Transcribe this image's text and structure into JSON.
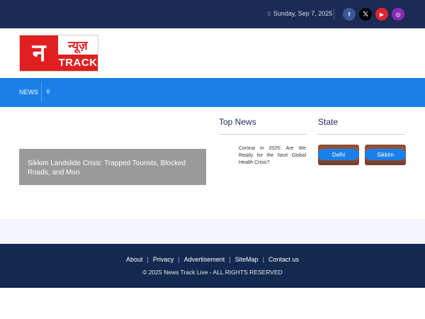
{
  "topbar": {
    "date": "Sunday, Sep 7, 2025",
    "social": [
      "facebook-icon",
      "x-icon",
      "youtube-icon",
      "instagram-icon"
    ]
  },
  "logo": {
    "mark": "न",
    "hindi": "न्यूज़",
    "word": "TRACK"
  },
  "nav": {
    "items": [
      "NEWS"
    ]
  },
  "feature": {
    "title": "Sikkim Landslide Crisis: Trapped Tourists, Blocked Roads, and Mon"
  },
  "top_news": {
    "heading": "Top News",
    "items": [
      "Corona in 2025: Are We Ready for the Next Global Health Crisis?"
    ]
  },
  "state": {
    "heading": "State",
    "items": [
      "Delhi",
      "Sikkim"
    ]
  },
  "footer": {
    "links": [
      "About",
      "Privacy",
      "Advertisement",
      "SiteMap",
      "Contact us"
    ],
    "separator": "|",
    "copyright": "© 2025 News Track Live - ALL RIGHTS RESERVED"
  },
  "colors": {
    "topbar": "#1b2b56",
    "nav": "#1a7fe8",
    "footer": "#13294f",
    "brand_red": "#e02020"
  }
}
